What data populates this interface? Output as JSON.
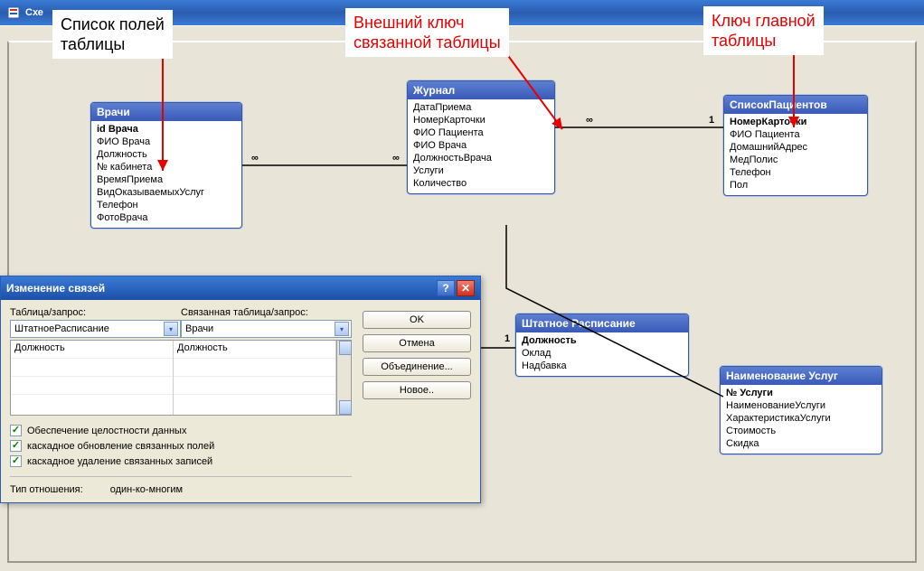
{
  "window": {
    "title": "Схе"
  },
  "callouts": {
    "c1": "Список полей\nтаблицы",
    "c2": "Внешний ключ\nсвязанной таблицы",
    "c3": "Ключ главной\nтаблицы"
  },
  "tables": {
    "vrachi": {
      "title": "Врачи",
      "fields": [
        "id Врача",
        "ФИО Врача",
        "Должность",
        "№ кабинета",
        "ВремяПриема",
        "ВидОказываемыхУслуг",
        "Телефон",
        "ФотоВрача"
      ],
      "key_index": 0
    },
    "zhurnal": {
      "title": "Журнал",
      "fields": [
        "ДатаПриема",
        "НомерКарточки",
        "ФИО Пациента",
        "ФИО Врача",
        "ДолжностьВрача",
        "Услуги",
        "Количество"
      ],
      "key_index": -1
    },
    "spisok": {
      "title": "СписокПациентов",
      "fields": [
        "НомерКарточки",
        "ФИО Пациента",
        "ДомашнийАдрес",
        "МедПолис",
        "Телефон",
        "Пол"
      ],
      "key_index": 0
    },
    "shtat": {
      "title": "Штатное Расписание",
      "fields": [
        "Должность",
        "Оклад",
        "Надбавка"
      ],
      "key_index": 0
    },
    "uslugi": {
      "title": "Наименование Услуг",
      "fields": [
        "№ Услуги",
        "НаименованиеУслуги",
        "ХарактеристикаУслуги",
        "Стоимость",
        "Скидка"
      ],
      "key_index": 0
    }
  },
  "relations": [
    {
      "from": "vrachi",
      "to": "zhurnal",
      "left_card": "∞",
      "right_card": "∞"
    },
    {
      "from": "zhurnal",
      "to": "spisok",
      "left_card": "∞",
      "right_card": "1"
    },
    {
      "from": "shtat",
      "to": "vrachi",
      "left_card": "1",
      "right_card": ""
    },
    {
      "from": "zhurnal",
      "to": "uslugi",
      "left_card": "",
      "right_card": ""
    }
  ],
  "dialog": {
    "title": "Изменение связей",
    "label_table": "Таблица/запрос:",
    "label_related": "Связанная таблица/запрос:",
    "combo_table": "ШтатноеРасписание",
    "combo_related": "Врачи",
    "field_left": "Должность",
    "field_right": "Должность",
    "btn_ok": "OK",
    "btn_cancel": "Отмена",
    "btn_join": "Объединение...",
    "btn_new": "Новое..",
    "chk1": "Обеспечение целостности данных",
    "chk2": "каскадное обновление связанных полей",
    "chk3": "каскадное удаление связанных записей",
    "reltype_label": "Тип отношения:",
    "reltype_value": "один-ко-многим"
  }
}
